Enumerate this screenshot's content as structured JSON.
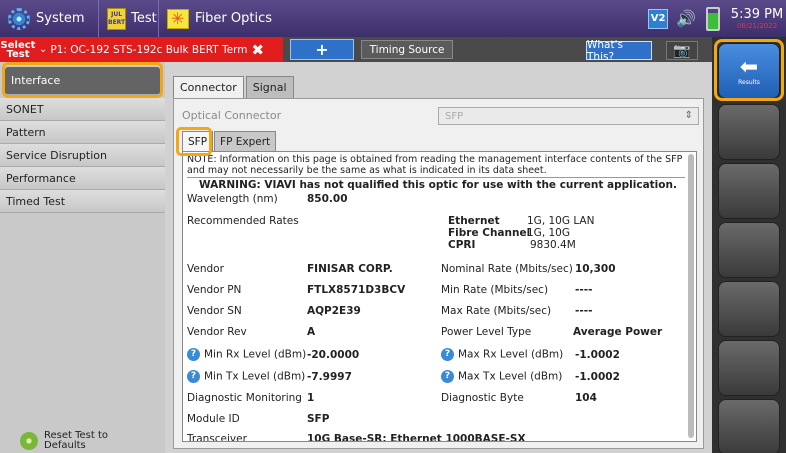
{
  "topbar": {
    "system_label": "System",
    "bert_icon_text_top": "JUL",
    "bert_icon_text_bottom": "BERT",
    "test_label": "Test",
    "fiber_label": "Fiber Optics",
    "v2_label": "V2",
    "time": "5:39 PM",
    "date": "08/21/2022"
  },
  "bar2": {
    "select_label_line1": "Select",
    "select_label_line2": "Test",
    "test_name": "P1: OC-192 STS-192c Bulk BERT Term",
    "add_label": "+",
    "timing_source_label": "Timing Source",
    "whats_this_label": "What's This?"
  },
  "sidebar": {
    "items": [
      {
        "label": "Interface"
      },
      {
        "label": "SONET"
      },
      {
        "label": "Pattern"
      },
      {
        "label": "Service Disruption"
      },
      {
        "label": "Performance"
      },
      {
        "label": "Timed Test"
      }
    ],
    "reset_line1": "Reset Test to",
    "reset_line2": "Defaults"
  },
  "main": {
    "tabs": [
      {
        "label": "Connector"
      },
      {
        "label": "Signal"
      }
    ],
    "optical_connector_label": "Optical Connector",
    "optical_connector_value": "SFP",
    "subtabs": [
      {
        "label": "SFP"
      },
      {
        "label": "FP Expert"
      }
    ],
    "note": "NOTE: Information on this page is obtained from reading the management interface contents of the SFP and may not necessarily be the same as what is indicated in its data sheet.",
    "warning": "WARNING: VIAVI has not qualified this optic for use with the current application.",
    "wavelength_label": "Wavelength (nm)",
    "wavelength_value": "850.00",
    "recommended_rates_label": "Recommended Rates",
    "rates": {
      "ethernet_label": "Ethernet",
      "ethernet_value": "1G, 10G LAN",
      "fc_label": "Fibre Channel",
      "fc_value": "1G, 10G",
      "cpri_label": "CPRI",
      "cpri_value": "9830.4M"
    },
    "vendor_label": "Vendor",
    "vendor_value": "FINISAR CORP.",
    "vendor_pn_label": "Vendor PN",
    "vendor_pn_value": "FTLX8571D3BCV",
    "vendor_sn_label": "Vendor SN",
    "vendor_sn_value": "AQP2E39",
    "vendor_rev_label": "Vendor Rev",
    "vendor_rev_value": "A",
    "min_rx_label": "Min Rx Level (dBm)",
    "min_rx_value": "-20.0000",
    "min_tx_label": "Min Tx Level (dBm)",
    "min_tx_value": "-7.9997",
    "diag_mon_label": "Diagnostic Monitoring",
    "diag_mon_value": "1",
    "module_id_label": "Module ID",
    "module_id_value": "SFP",
    "transceiver_label": "Transceiver",
    "transceiver_value": "10G Base-SR; Ethernet 1000BASE-SX",
    "nominal_rate_label": "Nominal Rate (Mbits/sec)",
    "nominal_rate_value": "10,300",
    "min_rate_label": "Min Rate (Mbits/sec)",
    "min_rate_value": "----",
    "max_rate_label": "Max Rate (Mbits/sec)",
    "max_rate_value": "----",
    "power_level_type_label": "Power Level Type",
    "power_level_type_value": "Average Power",
    "max_rx_label": "Max Rx Level (dBm)",
    "max_rx_value": "-1.0002",
    "max_tx_label": "Max Tx Level (dBm)",
    "max_tx_value": "-1.0002",
    "diag_byte_label": "Diagnostic Byte",
    "diag_byte_value": "104"
  },
  "rightbar": {
    "results_label": "Results"
  }
}
